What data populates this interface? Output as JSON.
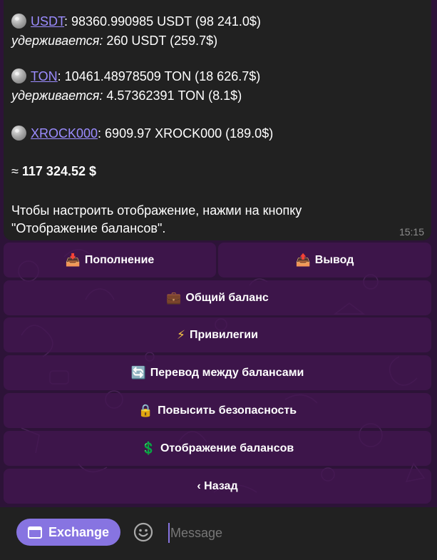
{
  "message": {
    "usdt": {
      "ticker": "USDT",
      "amount": ": 98360.990985 USDT (98 241.0$)",
      "held_label": "удерживается:",
      "held_value": " 260 USDT (259.7$)"
    },
    "ton": {
      "ticker": "TON",
      "amount": ": 10461.48978509 TON (18 626.7$)",
      "held_label": "удерживается:",
      "held_value": " 4.57362391 TON (8.1$)"
    },
    "xrock": {
      "ticker": "XROCK000",
      "amount": ": 6909.97 XROCK000 (189.0$)"
    },
    "total_prefix": "≈ ",
    "total": "117 324.52 $",
    "hint_line1": "Чтобы настроить отображение, нажми на кнопку",
    "hint_line2": "\"Отображение балансов\".",
    "time": "15:15"
  },
  "keyboard": {
    "deposit": {
      "emoji": "📥",
      "label": "Пополнение"
    },
    "withdraw": {
      "emoji": "📤",
      "label": "Вывод"
    },
    "total_balance": {
      "emoji": "💼",
      "label": "Общий баланс"
    },
    "privileges": {
      "emoji": "⚡",
      "label": "Привилегии"
    },
    "transfer": {
      "emoji": "🔄",
      "label": "Перевод между балансами"
    },
    "security": {
      "emoji": "🔒",
      "label": "Повысить безопасность"
    },
    "display": {
      "emoji": "💲",
      "label": "Отображение балансов"
    },
    "back": {
      "label": "‹ Назад"
    }
  },
  "composer": {
    "exchange_label": "Exchange",
    "placeholder": "Message",
    "icons": {
      "app": "app-window-icon",
      "emoji": "smile-icon"
    }
  },
  "colors": {
    "accent": "#8774e1",
    "link": "#9b8cff",
    "button_bg": "#441652",
    "bubble": "#212121"
  }
}
